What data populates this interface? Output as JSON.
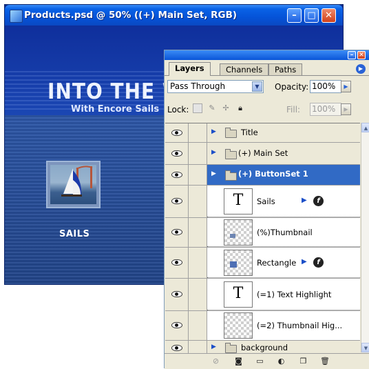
{
  "document": {
    "title": "Products.psd @ 50% ((+) Main Set, RGB)",
    "canvas": {
      "headline": "INTO THE WI",
      "subtitle": "With Encore Sails",
      "button_label": "SAILS"
    }
  },
  "palette": {
    "tabs": [
      "Layers",
      "Channels",
      "Paths"
    ],
    "active_tab": "Layers",
    "blend_mode": "Pass Through",
    "opacity_label": "Opacity:",
    "opacity_value": "100%",
    "lock_label": "Lock:",
    "fill_label": "Fill:",
    "fill_value": "100%",
    "layers": [
      {
        "name": "Title",
        "kind": "group",
        "visible": true
      },
      {
        "name": "(+) Main Set",
        "kind": "group",
        "visible": true
      },
      {
        "name": "(+) ButtonSet 1",
        "kind": "group",
        "visible": true,
        "selected": true
      },
      {
        "name": "Sails",
        "kind": "text",
        "visible": true,
        "fx": true
      },
      {
        "name": "(%)Thumbnail",
        "kind": "image",
        "visible": true
      },
      {
        "name": "Rectangle",
        "kind": "image",
        "visible": true,
        "fx": true
      },
      {
        "name": "(=1) Text Highlight",
        "kind": "text",
        "visible": true
      },
      {
        "name": "(=2) Thumbnail Hig...",
        "kind": "image",
        "visible": true
      },
      {
        "name": "background",
        "kind": "group",
        "visible": true
      }
    ],
    "bottom_icons": [
      "link-layers-icon",
      "add-mask-icon",
      "new-set-icon",
      "adjustment-layer-icon",
      "new-layer-icon",
      "trash-icon"
    ]
  },
  "colors": {
    "xp_blue": "#0a55d8",
    "selection": "#316ac5",
    "palette_bg": "#ece9d8"
  }
}
